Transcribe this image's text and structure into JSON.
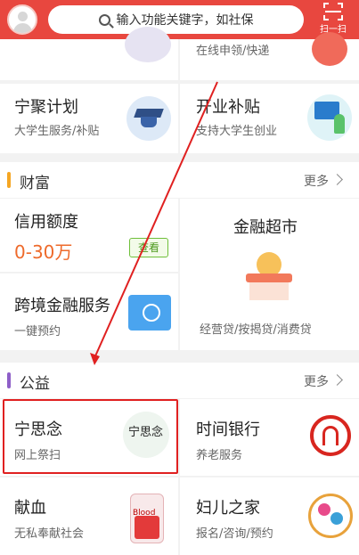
{
  "search": {
    "placeholder": "输入功能关键字，如社保"
  },
  "scan": {
    "label": "扫一扫"
  },
  "top_partial": {
    "subtitle": "在线申领/快递"
  },
  "row1": [
    {
      "title": "宁聚计划",
      "subtitle": "大学生服务/补贴"
    },
    {
      "title": "开业补贴",
      "subtitle": "支持大学生创业"
    }
  ],
  "wealth": {
    "header": "财富",
    "more": "更多",
    "credit": {
      "title": "信用额度",
      "amount": "0-30万",
      "button": "查看"
    },
    "market": {
      "title": "金融超市",
      "subtitle": "经营贷/按揭贷/消费贷"
    },
    "crossborder": {
      "title": "跨境金融服务",
      "subtitle": "一键预约"
    }
  },
  "welfare": {
    "header": "公益",
    "more": "更多",
    "items": [
      {
        "title": "宁思念",
        "subtitle": "网上祭扫",
        "logo_text": "宁思念"
      },
      {
        "title": "时间银行",
        "subtitle": "养老服务"
      },
      {
        "title": "献血",
        "subtitle": "无私奉献社会",
        "bag_label": "Blood"
      },
      {
        "title": "妇儿之家",
        "subtitle": "报名/咨询/预约"
      }
    ]
  },
  "colors": {
    "brand": "#e8473f",
    "wealth_bar": "#f5a623",
    "welfare_bar": "#8e5fc8",
    "amount": "#ee6a2b"
  }
}
